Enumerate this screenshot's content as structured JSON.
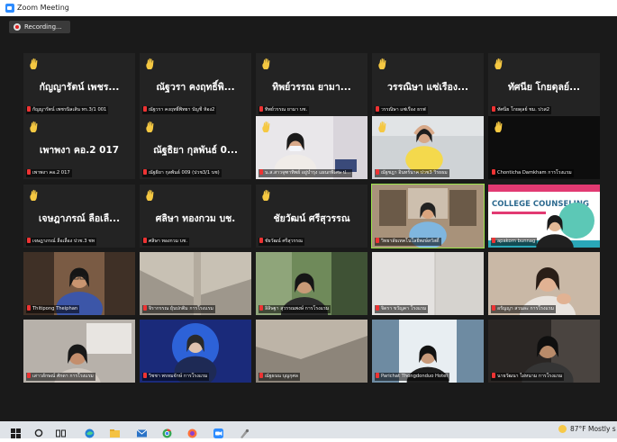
{
  "window": {
    "title": "Zoom Meeting",
    "recording_label": "Recording..."
  },
  "tiles": [
    {
      "big_name": "กัญญารัตน์ เพชร...",
      "label": "กัญญารัตน์ เพชรนิลเส้น ทร.3/1 001",
      "hand": true
    },
    {
      "big_name": "ณัฐวรา คงฤทธิ์พิ...",
      "label": "ณัฐวรา คงฤทธิ์พิทยา บัญชี ห้อง2",
      "hand": true
    },
    {
      "big_name": "ทิพย์วรรณ ยามา...",
      "label": "ทิพย์วรรณ ยามา บช.",
      "hand": true
    },
    {
      "big_name": "วรรณิษา แซ่เรือง...",
      "label": "วรรณิษา แซ่เรือง ธรฟ",
      "hand": true
    },
    {
      "big_name": "ทัศนีย โกยดุลย์...",
      "label": "ทัศนีย โกยดุลย์ ชม. ปวส2",
      "hand": true
    },
    {
      "big_name": "เพาพงา คอ.2 017",
      "label": "เพาพงา คอ.2 017",
      "hand": true
    },
    {
      "big_name": "ณัฐธิยา กุลพันธ์ 0...",
      "label": "ณัฐธิยา กุลพันธ์ 009 (ปวช3/1 บช)",
      "hand": true
    },
    {
      "big_name": "",
      "label": "น.ส.สาวจุฑาทิพย์ อยู่บำรุง แผนกพิเศษ ป...",
      "hand": true,
      "video": "girl-mask"
    },
    {
      "big_name": "",
      "label": "ณัฐชฎา อินทร์นาค ปวช3 วิรยธม",
      "hand": true,
      "video": "girl-yellow"
    },
    {
      "big_name": "",
      "label": "Chonticha Damkham การโรงแรม",
      "hand": true,
      "video": "dark"
    },
    {
      "big_name": "เจษฎาภรณ์ ลือเลื...",
      "label": "เจษฎาภรณ์ ลือเลื่อง ปวช.3 ชท",
      "hand": true
    },
    {
      "big_name": "ศลิษา ทองกวม บช.",
      "label": "ศลิษา ทองกวม บช.",
      "hand": true
    },
    {
      "big_name": "ชัยวัฒน์ ศรีสุวรรณ",
      "label": "ชัยวัฒน์ ศรีสุวรรณ",
      "hand": true
    },
    {
      "big_name": "",
      "label": "วิทยาลัยเทคโนโลยีพงษ์สวัสดิ์",
      "hand": false,
      "video": "teacher",
      "active": true
    },
    {
      "big_name": "",
      "label": "apakorn bunnag",
      "hand": false,
      "video": "slide",
      "slide_text": "COLLEGE COUNSELING"
    },
    {
      "big_name": "",
      "label": "Thitipong Theiphan",
      "hand": false,
      "video": "boy"
    },
    {
      "big_name": "",
      "label": "จิรากรรณ ยุ้นปกติม การโรงแรม",
      "hand": false,
      "video": "ceiling"
    },
    {
      "big_name": "",
      "label": "ลิลิษฐา สุวรรณพงษ์ การโรงแรม",
      "hand": false,
      "video": "girl-green"
    },
    {
      "big_name": "",
      "label": "จิดรา ขวัญคา โรงแรม",
      "hand": false,
      "video": "wall"
    },
    {
      "big_name": "",
      "label": "อรัญญา สวนละ การโรงแรม",
      "hand": false,
      "video": "girl-hand"
    },
    {
      "big_name": "",
      "label": "เสาวลักษณ์ ศักดา การโรงแรม",
      "hand": false,
      "video": "girl-room"
    },
    {
      "big_name": "",
      "label": "วิชชา พรหมจักษ์ การโรงแรม",
      "hand": false,
      "video": "boy-blue"
    },
    {
      "big_name": "",
      "label": "ณัฐธนน บุญกุศล",
      "hand": false,
      "video": "ceiling2"
    },
    {
      "big_name": "",
      "label": "Parichat Thongdonduo Hotel",
      "hand": false,
      "video": "girl-curtain"
    },
    {
      "big_name": "",
      "label": "นายวัฒนา ไผ่หนาม การโรงแรม",
      "hand": false,
      "video": "boy-dark"
    }
  ],
  "taskbar": {
    "icons": [
      "windows-icon",
      "search-icon",
      "task-view-icon",
      "edge-icon",
      "file-explorer-icon",
      "mail-icon",
      "chrome-icon",
      "firefox-icon",
      "zoom-icon",
      "paint-icon"
    ],
    "weather_text": "87°F  Mostly s"
  }
}
